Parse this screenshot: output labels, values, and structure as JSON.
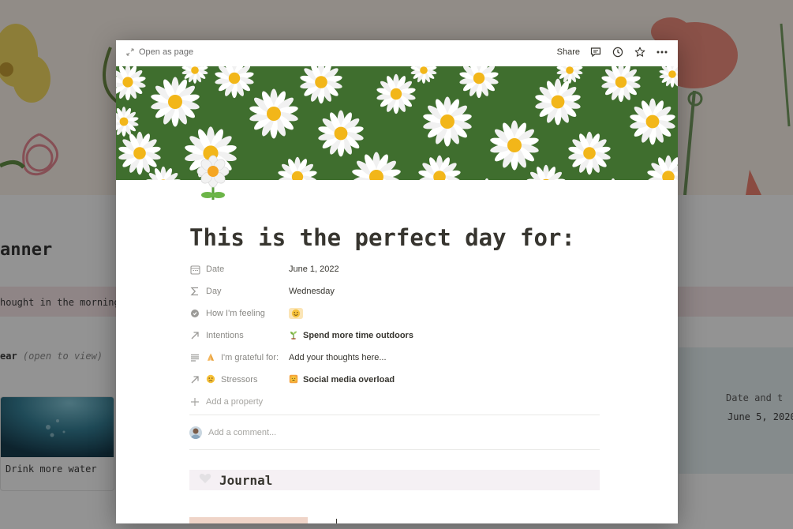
{
  "background": {
    "title_fragment": "anner",
    "callout_fragment": "hought in the morning",
    "toggle_bold": "ear",
    "toggle_hint": "(open to view)",
    "card_label": "Drink more water",
    "table_header": "Date and t",
    "table_cell": "June 5, 2020"
  },
  "modal": {
    "open_as_page": "Open as page",
    "share": "Share",
    "icons": [
      "expand-icon",
      "comment-icon",
      "history-icon",
      "star-icon",
      "more-icon"
    ]
  },
  "page": {
    "icon": "daisy-icon",
    "title": "This is the perfect day for:",
    "properties": [
      {
        "name": "Date",
        "icon": "calendar-icon",
        "value": "June 1, 2022"
      },
      {
        "name": "Day",
        "icon": "sigma-icon",
        "value": "Wednesday"
      },
      {
        "name": "How I'm feeling",
        "icon": "circle-icon",
        "value": ""
      },
      {
        "name": "Intentions",
        "icon": "relation-arrow-icon",
        "value": "Spend more time outdoors"
      },
      {
        "name": "I'm grateful for:",
        "icon": "text-lines-icon",
        "value": "Add your thoughts here..."
      },
      {
        "name": "Stressors",
        "icon": "relation-arrow-icon",
        "value": "Social media overload"
      }
    ],
    "add_property": "Add a property",
    "add_comment": "Add a comment...",
    "journal_label": "Journal"
  },
  "colors": {
    "accent_text": "#37352f",
    "muted_text": "#8a8985",
    "journal_bg": "#f5f0f4",
    "mood_chip": "#fbe5b6"
  }
}
